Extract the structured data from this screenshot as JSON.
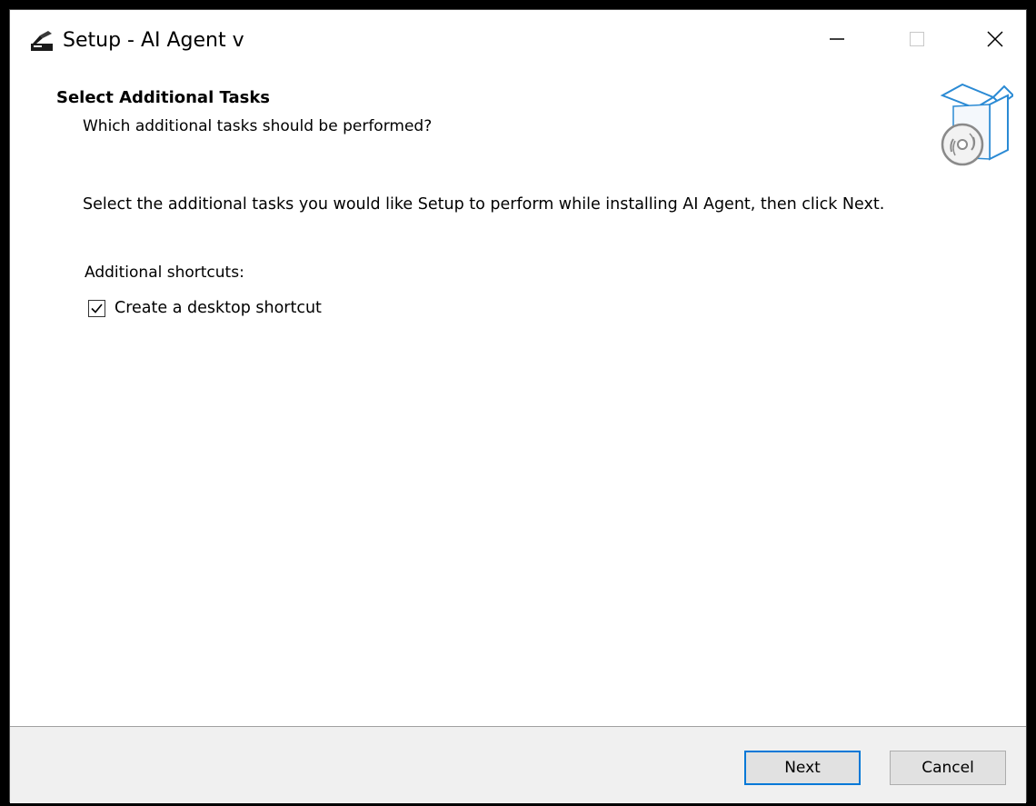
{
  "window": {
    "title": "Setup - AI Agent v",
    "controls": {
      "minimize": "minimize-icon",
      "maximize": "maximize-icon",
      "close": "close-icon"
    }
  },
  "header": {
    "title": "Select Additional Tasks",
    "subtitle": "Which additional tasks should be performed?",
    "image": "software-box-icon"
  },
  "content": {
    "instructions": "Select the additional tasks you would like Setup to perform while installing AI Agent, then click Next.",
    "group_label": "Additional shortcuts:",
    "tasks": [
      {
        "label": "Create a desktop shortcut",
        "checked": true
      }
    ]
  },
  "footer": {
    "next_label": "Next",
    "cancel_label": "Cancel"
  },
  "colors": {
    "accent": "#0078d7",
    "footer_bg": "#f0f0f0",
    "button_bg": "#e1e1e1"
  }
}
